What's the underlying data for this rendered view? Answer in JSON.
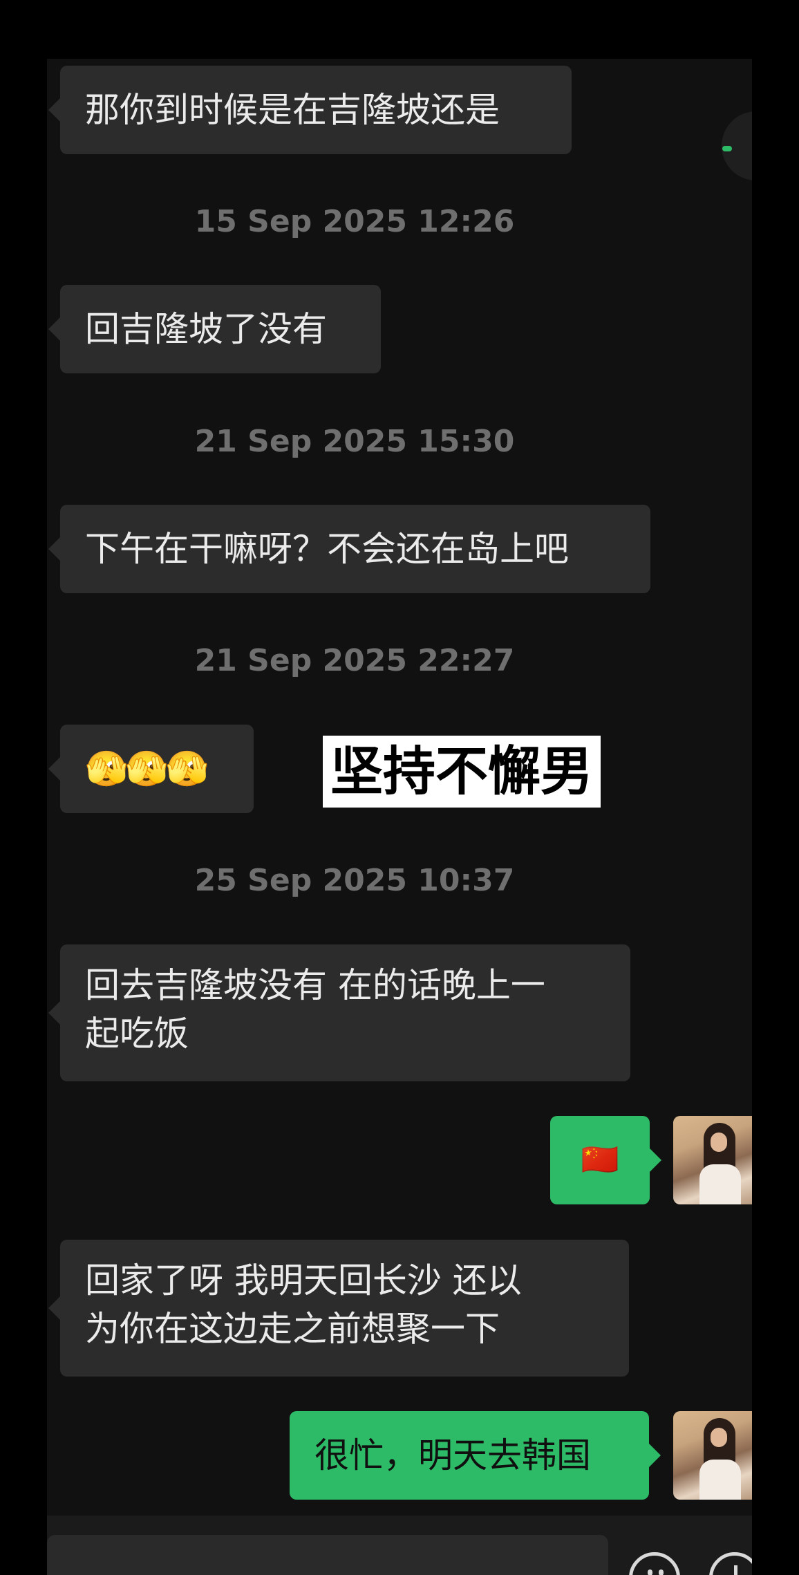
{
  "messages": [
    {
      "dir": "in",
      "text": "那你到时候是在吉隆坡还是"
    },
    {
      "timestamp": "15 Sep 2025 12:26"
    },
    {
      "dir": "in",
      "text": "回吉隆坡了没有"
    },
    {
      "timestamp": "21 Sep 2025 15:30"
    },
    {
      "dir": "in",
      "text": "下午在干嘛呀？不会还在岛上吧"
    },
    {
      "timestamp": "21 Sep 2025 22:27"
    },
    {
      "dir": "in",
      "text": "🫣🫣🫣"
    },
    {
      "overlay": "坚持不懈男"
    },
    {
      "timestamp": "25 Sep 2025 10:37"
    },
    {
      "dir": "in",
      "lines": [
        "回去吉隆坡没有  在的话晚上一",
        "起吃饭"
      ]
    },
    {
      "dir": "out",
      "text": "🇨🇳"
    },
    {
      "dir": "in",
      "lines": [
        "回家了呀   我明天回长沙   还以",
        "为你在这边走之前想聚一下"
      ]
    },
    {
      "dir": "out",
      "text": "很忙，明天去韩国"
    }
  ],
  "icons": {
    "emoji_button": "smiley-icon",
    "more_button": "plus-icon",
    "side_button": "wechat-float-icon"
  },
  "colors": {
    "incoming_bubble": "#2c2c2c",
    "outgoing_bubble": "#2dbb67",
    "timestamp": "#6f6f6f",
    "chat_background": "#111111"
  }
}
